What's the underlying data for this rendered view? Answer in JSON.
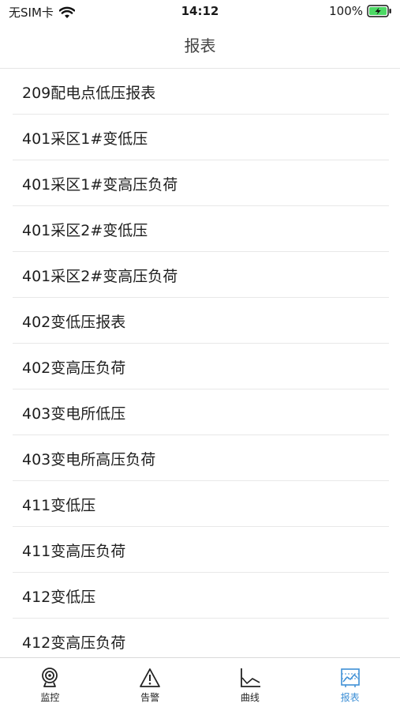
{
  "status_bar": {
    "carrier": "无SIM卡",
    "time": "14:12",
    "battery": "100%"
  },
  "nav": {
    "title": "报表"
  },
  "reports": [
    "209配电点低压报表",
    "401采区1#变低压",
    "401采区1#变高压负荷",
    "401采区2#变低压",
    "401采区2#变高压负荷",
    "402变低压报表",
    "402变高压负荷",
    "403变电所低压",
    "403变电所高压负荷",
    "411变低压",
    "411变高压负荷",
    "412变低压",
    "412变高压负荷"
  ],
  "tabs": [
    {
      "label": "监控",
      "icon": "camera-icon"
    },
    {
      "label": "告警",
      "icon": "warning-icon"
    },
    {
      "label": "曲线",
      "icon": "line-chart-icon"
    },
    {
      "label": "报表",
      "icon": "report-icon",
      "active": true
    }
  ],
  "colors": {
    "accent": "#3d8fd6",
    "battery_green": "#4cd964"
  }
}
